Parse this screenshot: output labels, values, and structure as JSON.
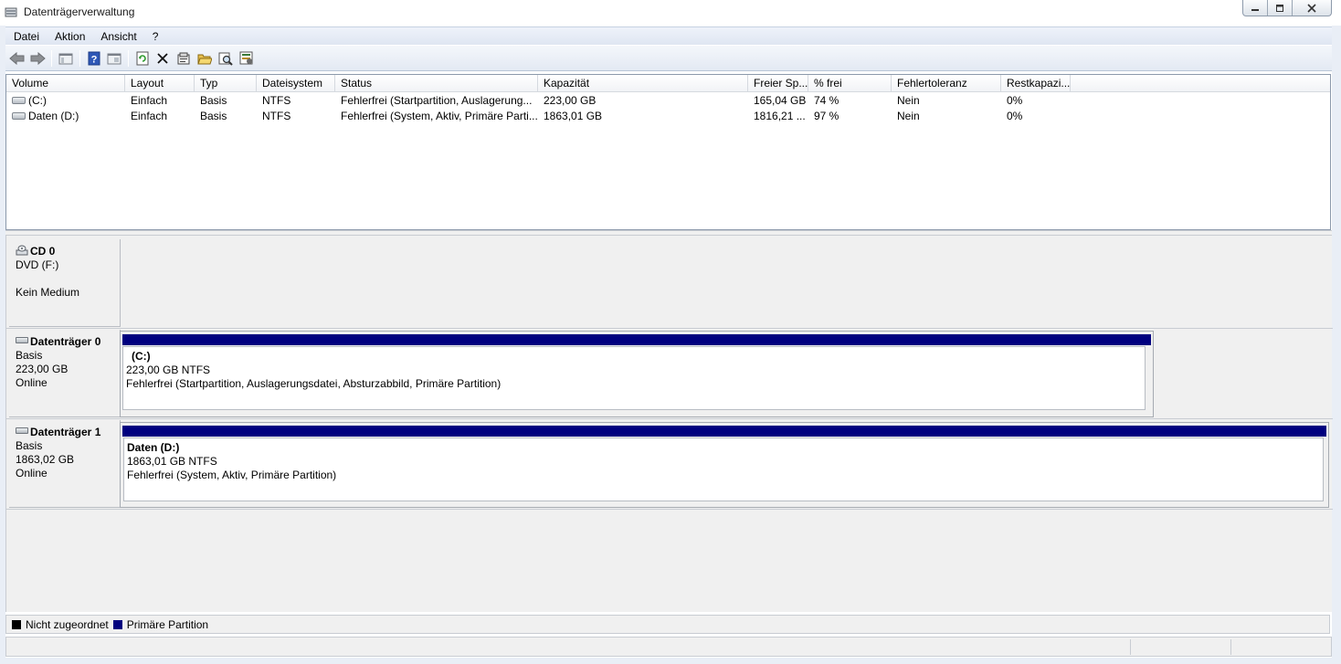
{
  "window": {
    "title": "Datenträgerverwaltung"
  },
  "menu": [
    "Datei",
    "Aktion",
    "Ansicht",
    "?"
  ],
  "toolbar_icons": [
    "back-icon",
    "forward-icon",
    "console-tree-icon",
    "help-icon",
    "view-icon",
    "refresh-icon",
    "delete-icon",
    "properties-icon",
    "open-icon",
    "find-icon",
    "settings-icon"
  ],
  "volume_table": {
    "columns": [
      "Volume",
      "Layout",
      "Typ",
      "Dateisystem",
      "Status",
      "Kapazität",
      "Freier Sp...",
      "% frei",
      "Fehlertoleranz",
      "Restkapazi..."
    ],
    "rows": [
      [
        "(C:)",
        "Einfach",
        "Basis",
        "NTFS",
        "Fehlerfrei (Startpartition, Auslagerung...",
        "223,00 GB",
        "165,04 GB",
        "74 %",
        "Nein",
        "0%"
      ],
      [
        "Daten (D:)",
        "Einfach",
        "Basis",
        "NTFS",
        "Fehlerfrei (System, Aktiv, Primäre Parti...",
        "1863,01 GB",
        "1816,21 ...",
        "97 %",
        "Nein",
        "0%"
      ]
    ]
  },
  "disks": [
    {
      "name": "CD 0",
      "line1": "DVD (F:)",
      "line2": "",
      "line3": "Kein Medium"
    },
    {
      "name": "Datenträger 0",
      "line1": "Basis",
      "line2": "223,00 GB",
      "line3": "Online",
      "partition": {
        "name": "(C:)",
        "size": "223,00 GB NTFS",
        "status": "Fehlerfrei (Startpartition, Auslagerungsdatei, Absturzabbild, Primäre Partition)"
      }
    },
    {
      "name": "Datenträger 1",
      "line1": "Basis",
      "line2": "1863,02 GB",
      "line3": "Online",
      "partition": {
        "name": "Daten  (D:)",
        "size": "1863,01 GB NTFS",
        "status": "Fehlerfrei (System, Aktiv, Primäre Partition)"
      }
    }
  ],
  "legend": [
    {
      "label": "Nicht zugeordnet",
      "color": "#000000"
    },
    {
      "label": "Primäre Partition",
      "color": "#00007f"
    }
  ]
}
